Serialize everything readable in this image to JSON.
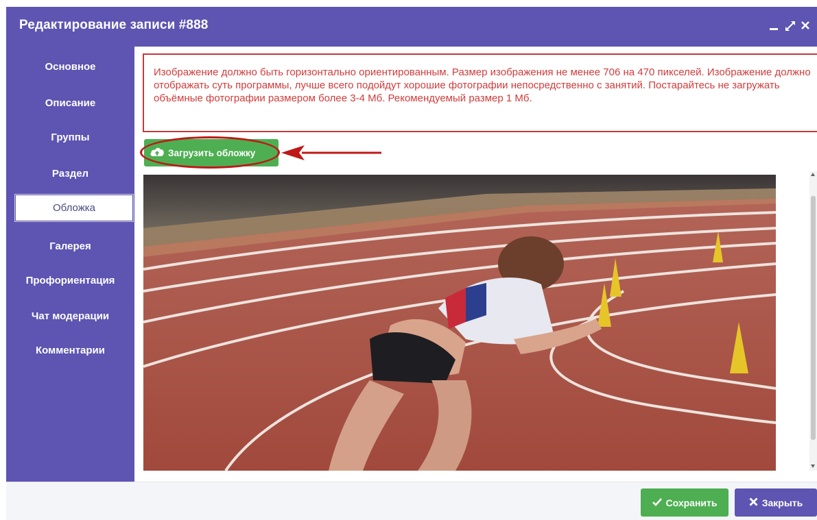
{
  "window": {
    "title": "Редактирование записи #888"
  },
  "sidebar": {
    "items": [
      {
        "label": "Основное"
      },
      {
        "label": "Описание"
      },
      {
        "label": "Группы"
      },
      {
        "label": "Раздел"
      },
      {
        "label": "Обложка"
      },
      {
        "label": "Галерея"
      },
      {
        "label": "Профориентация"
      },
      {
        "label": "Чат модерации"
      },
      {
        "label": "Комментарии"
      }
    ],
    "active": "Обложка"
  },
  "notice": {
    "text": "Изображение должно быть горизонтально ориентированным. Размер изображения не менее 706 на 470 пикселей. Изображение должно отображать суть программы, лучше всего подойдут хорошие фотографии непосредственно с занятий. Постарайтесь не загружать объёмные фотографии размером более 3-4 Мб. Рекомендуемый размер 1 Мб."
  },
  "upload": {
    "label": "Загрузить обложку",
    "icon": "cloud-upload-icon"
  },
  "cover_image": {
    "subject": "sprinter-on-track-photo"
  },
  "footer": {
    "save_label": "Сохранить",
    "close_label": "Закрыть"
  },
  "colors": {
    "header": "#5d55b1",
    "success": "#4daf52",
    "notice": "#d23b3b",
    "highlight": "#c01818"
  }
}
